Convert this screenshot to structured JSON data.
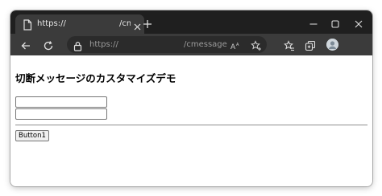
{
  "browser": {
    "tab": {
      "title_start": "https://",
      "title_end": "/cm",
      "favicon": "page-icon",
      "close_icon": "close-icon"
    },
    "new_tab_icon": "plus-icon",
    "window_controls": [
      "minimize-icon",
      "maximize-icon",
      "close-icon"
    ],
    "toolbar": {
      "back_icon": "back-arrow-icon",
      "refresh_icon": "refresh-icon",
      "url_start": "https://",
      "url_end": "/cmessage",
      "lock_icon": "lock-icon",
      "read_aloud_icon": "read-aloud-icon",
      "add_favorite_icon": "add-favorite-icon",
      "favorites_icon": "favorites-icon",
      "collections_icon": "collections-icon",
      "profile_icon": "avatar"
    }
  },
  "page": {
    "heading": "切断メッセージのカスタマイズデモ",
    "inputs": [
      {
        "value": "",
        "placeholder": ""
      },
      {
        "value": "",
        "placeholder": ""
      }
    ],
    "button_label": "Button1"
  },
  "colors": {
    "tabstrip": "#1f1f1f",
    "toolbar": "#3b3b3b",
    "addressbar": "#2b2b2b",
    "page_background": "#ffffff"
  }
}
